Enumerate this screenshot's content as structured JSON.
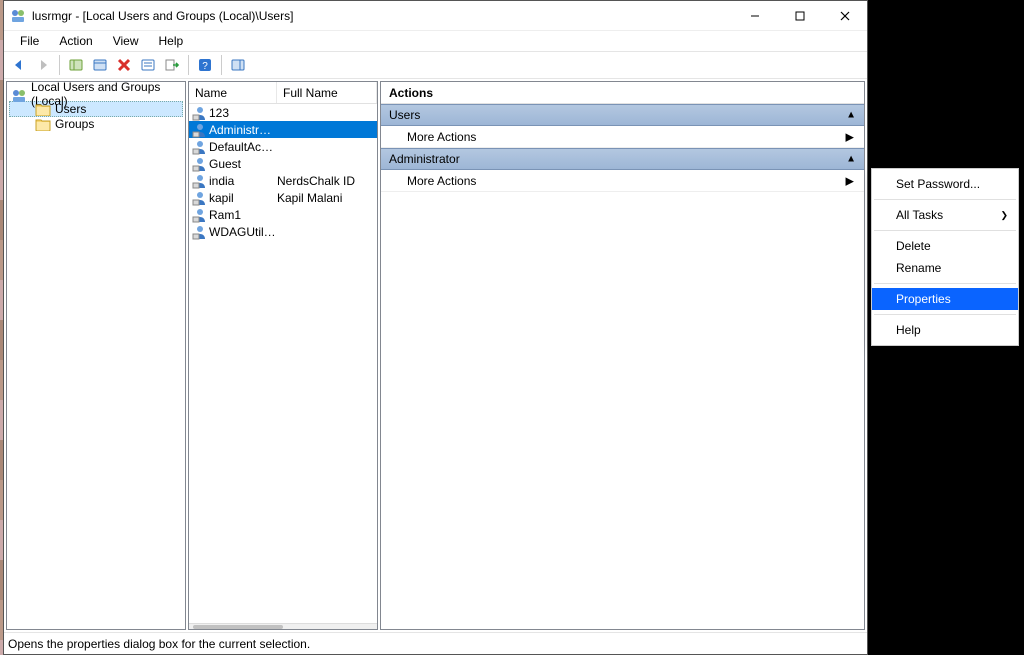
{
  "title": "lusrmgr - [Local Users and Groups (Local)\\Users]",
  "menubar": {
    "file": "File",
    "action": "Action",
    "view": "View",
    "help": "Help"
  },
  "tree": {
    "root": "Local Users and Groups (Local)",
    "users": "Users",
    "groups": "Groups"
  },
  "list": {
    "headers": {
      "name": "Name",
      "fullname": "Full Name"
    },
    "rows": [
      {
        "name": "123",
        "fullname": ""
      },
      {
        "name": "Administrator",
        "fullname": "",
        "selected": true
      },
      {
        "name": "DefaultAcco...",
        "fullname": ""
      },
      {
        "name": "Guest",
        "fullname": ""
      },
      {
        "name": "india",
        "fullname": "NerdsChalk ID"
      },
      {
        "name": "kapil",
        "fullname": "Kapil Malani"
      },
      {
        "name": "Ram1",
        "fullname": ""
      },
      {
        "name": "WDAGUtility...",
        "fullname": ""
      }
    ]
  },
  "actions": {
    "title": "Actions",
    "section_users": "Users",
    "section_admin": "Administrator",
    "more": "More Actions"
  },
  "context_menu": {
    "set_password": "Set Password...",
    "all_tasks": "All Tasks",
    "delete": "Delete",
    "rename": "Rename",
    "properties": "Properties",
    "help": "Help"
  },
  "statusbar": "Opens the properties dialog box for the current selection."
}
